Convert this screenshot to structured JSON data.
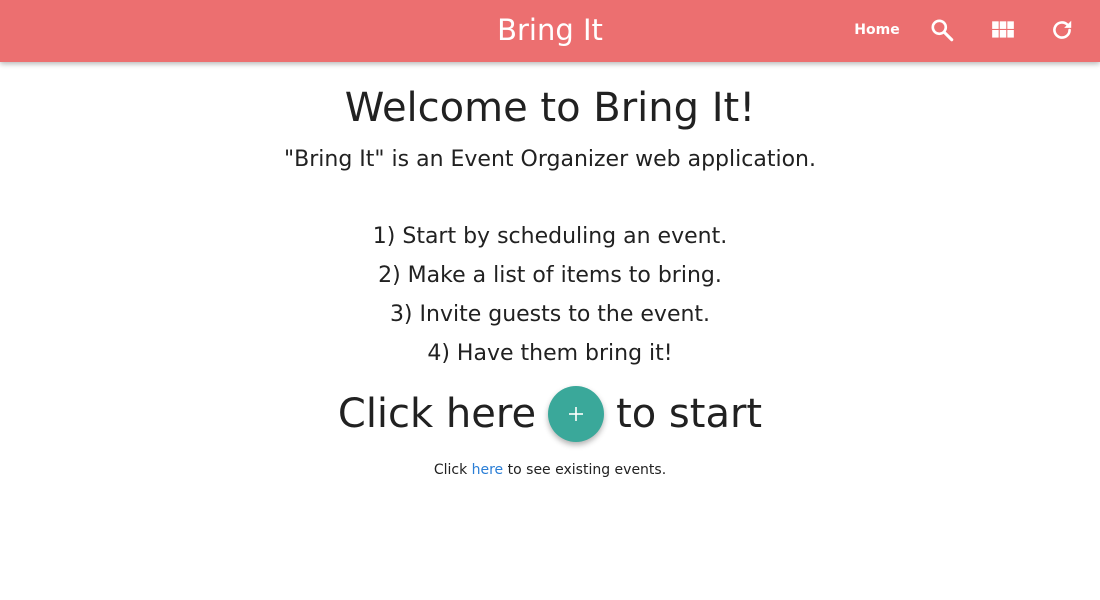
{
  "toolbar": {
    "title": "Bring It",
    "home_label": "Home",
    "icons": [
      "search-icon",
      "apps-grid-icon",
      "refresh-icon"
    ],
    "background_color": "#ec6f70"
  },
  "main": {
    "heading": "Welcome to Bring It!",
    "tagline": "\"Bring It\" is an Event Organizer web application.",
    "steps": [
      "1) Start by scheduling an event.",
      "2) Make a list of items to bring.",
      "3) Invite guests to the event.",
      "4) Have them bring it!"
    ],
    "cta_before": "Click here",
    "cta_after": "to start",
    "fab_icon": "plus-icon",
    "fab_color": "#3aa89a",
    "existing_prefix": "Click",
    "existing_link": "here",
    "existing_suffix": "to see existing events.",
    "link_color": "#2a7ed6"
  }
}
